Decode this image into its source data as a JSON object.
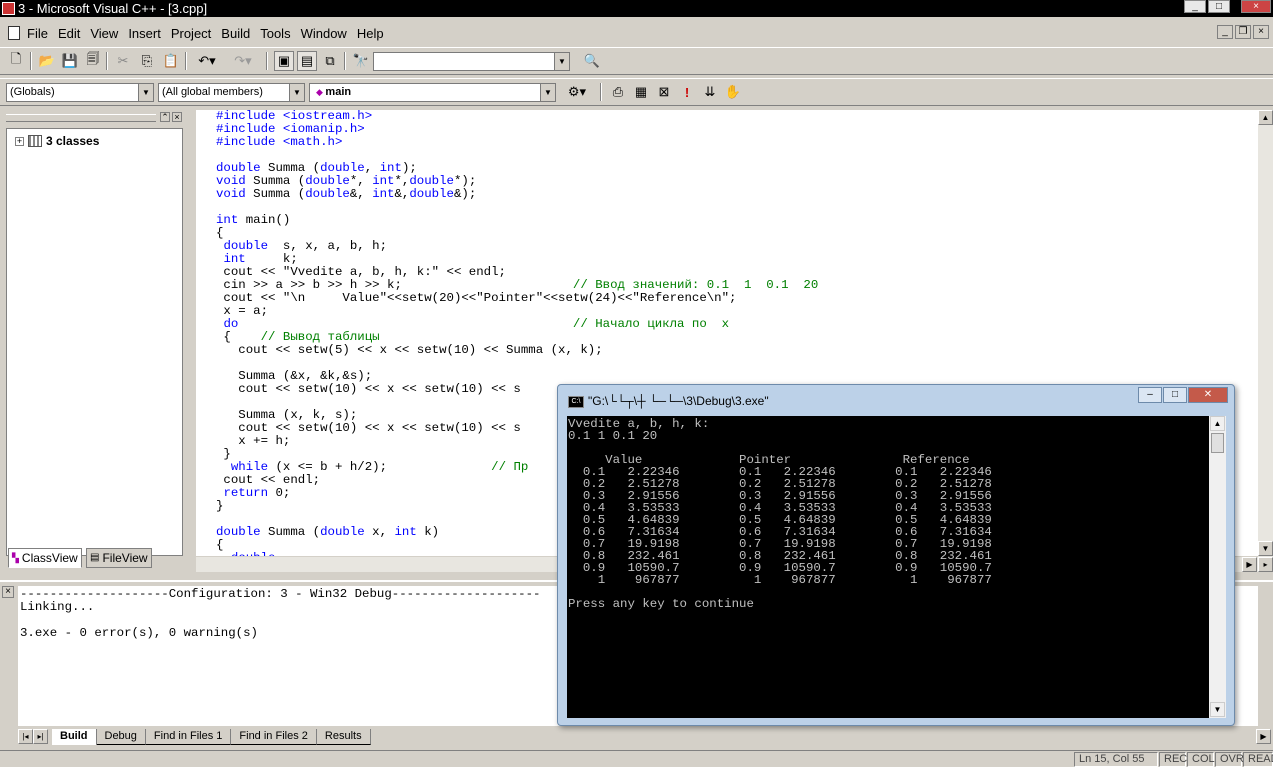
{
  "window": {
    "title": "3 - Microsoft Visual C++ - [3.cpp]"
  },
  "menu": [
    "File",
    "Edit",
    "View",
    "Insert",
    "Project",
    "Build",
    "Tools",
    "Window",
    "Help"
  ],
  "wizard_bar": {
    "scope": "(Globals)",
    "filter": "(All global members)",
    "member": "main"
  },
  "workspace": {
    "root": "3 classes",
    "tabs": [
      "ClassView",
      "FileView"
    ]
  },
  "editor": {
    "lines": [
      [
        [
          "pp",
          "#include <iostream.h>"
        ]
      ],
      [
        [
          "pp",
          "#include <iomanip.h>"
        ]
      ],
      [
        [
          "pp",
          "#include <math.h>"
        ]
      ],
      [
        [
          "t",
          ""
        ]
      ],
      [
        [
          "kw",
          "double"
        ],
        [
          "t",
          " Summa ("
        ],
        [
          "kw",
          "double"
        ],
        [
          "t",
          ", "
        ],
        [
          "kw",
          "int"
        ],
        [
          "t",
          ");"
        ]
      ],
      [
        [
          "kw",
          "void"
        ],
        [
          "t",
          " Summa ("
        ],
        [
          "kw",
          "double"
        ],
        [
          "t",
          "*, "
        ],
        [
          "kw",
          "int"
        ],
        [
          "t",
          "*,"
        ],
        [
          "kw",
          "double"
        ],
        [
          "t",
          "*);"
        ]
      ],
      [
        [
          "kw",
          "void"
        ],
        [
          "t",
          " Summa ("
        ],
        [
          "kw",
          "double"
        ],
        [
          "t",
          "&, "
        ],
        [
          "kw",
          "int"
        ],
        [
          "t",
          "&,"
        ],
        [
          "kw",
          "double"
        ],
        [
          "t",
          "&);"
        ]
      ],
      [
        [
          "t",
          ""
        ]
      ],
      [
        [
          "kw",
          "int"
        ],
        [
          "t",
          " main()"
        ]
      ],
      [
        [
          "t",
          "{"
        ]
      ],
      [
        [
          "t",
          " "
        ],
        [
          "kw",
          "double"
        ],
        [
          "t",
          "  s, x, a, b, h;"
        ]
      ],
      [
        [
          "t",
          " "
        ],
        [
          "kw",
          "int"
        ],
        [
          "t",
          "     k;"
        ]
      ],
      [
        [
          "t",
          " cout << \"Vvedite a, b, h, k:\" << endl;"
        ]
      ],
      [
        [
          "t",
          " cin >> a >> b >> h >> k;                       "
        ],
        [
          "cm",
          "// Ввод значений: 0.1  1  0.1  20"
        ]
      ],
      [
        [
          "t",
          " cout << \"\\n     Value\"<<setw(20)<<\"Pointer\"<<setw(24)<<\"Reference\\n\";"
        ]
      ],
      [
        [
          "t",
          " x = a;"
        ]
      ],
      [
        [
          "t",
          " "
        ],
        [
          "kw",
          "do"
        ],
        [
          "t",
          "                                             "
        ],
        [
          "cm",
          "// Начало цикла по  x"
        ]
      ],
      [
        [
          "t",
          " {    "
        ],
        [
          "cm",
          "// Вывод таблицы"
        ]
      ],
      [
        [
          "t",
          "   cout << setw(5) << x << setw(10) << Summa (x, k);"
        ]
      ],
      [
        [
          "t",
          ""
        ]
      ],
      [
        [
          "t",
          "   Summa (&x, &k,&s);"
        ]
      ],
      [
        [
          "t",
          "   cout << setw(10) << x << setw(10) << s"
        ]
      ],
      [
        [
          "t",
          ""
        ]
      ],
      [
        [
          "t",
          "   Summa (x, k, s);"
        ]
      ],
      [
        [
          "t",
          "   cout << setw(10) << x << setw(10) << s"
        ]
      ],
      [
        [
          "t",
          "   x += h;"
        ]
      ],
      [
        [
          "t",
          " }"
        ]
      ],
      [
        [
          "t",
          "  "
        ],
        [
          "kw",
          "while"
        ],
        [
          "t",
          " (x <= b + h/2);              "
        ],
        [
          "cm",
          "// Пр"
        ]
      ],
      [
        [
          "t",
          " cout << endl;"
        ]
      ],
      [
        [
          "t",
          " "
        ],
        [
          "kw",
          "return"
        ],
        [
          "t",
          " 0;"
        ]
      ],
      [
        [
          "t",
          "}"
        ]
      ],
      [
        [
          "t",
          ""
        ]
      ],
      [
        [
          "kw",
          "double"
        ],
        [
          "t",
          " Summa ("
        ],
        [
          "kw",
          "double"
        ],
        [
          "t",
          " x, "
        ],
        [
          "kw",
          "int"
        ],
        [
          "t",
          " k)"
        ]
      ],
      [
        [
          "t",
          "{"
        ]
      ],
      [
        [
          "t",
          "  "
        ],
        [
          "kw",
          "double"
        ]
      ]
    ]
  },
  "output": {
    "lines": [
      "--------------------Configuration: 3 - Win32 Debug--------------------",
      "Linking...",
      "",
      "3.exe - 0 error(s), 0 warning(s)"
    ],
    "tabs": [
      "Build",
      "Debug",
      "Find in Files 1",
      "Find in Files 2",
      "Results"
    ]
  },
  "console": {
    "title": "\"G:\\└└┬\\┼ └─└─\\3\\Debug\\3.exe\"",
    "lines": [
      "Vvedite a, b, h, k:",
      "0.1 1 0.1 20",
      "",
      "     Value             Pointer               Reference",
      "  0.1   2.22346        0.1   2.22346        0.1   2.22346",
      "  0.2   2.51278        0.2   2.51278        0.2   2.51278",
      "  0.3   2.91556        0.3   2.91556        0.3   2.91556",
      "  0.4   3.53533        0.4   3.53533        0.4   3.53533",
      "  0.5   4.64839        0.5   4.64839        0.5   4.64839",
      "  0.6   7.31634        0.6   7.31634        0.6   7.31634",
      "  0.7   19.9198        0.7   19.9198        0.7   19.9198",
      "  0.8   232.461        0.8   232.461        0.8   232.461",
      "  0.9   10590.7        0.9   10590.7        0.9   10590.7",
      "    1    967877          1    967877          1    967877",
      "",
      "Press any key to continue"
    ]
  },
  "status": {
    "position": "Ln 15, Col 55",
    "indicators": [
      "REC",
      "COL",
      "OVR",
      "READ"
    ]
  }
}
